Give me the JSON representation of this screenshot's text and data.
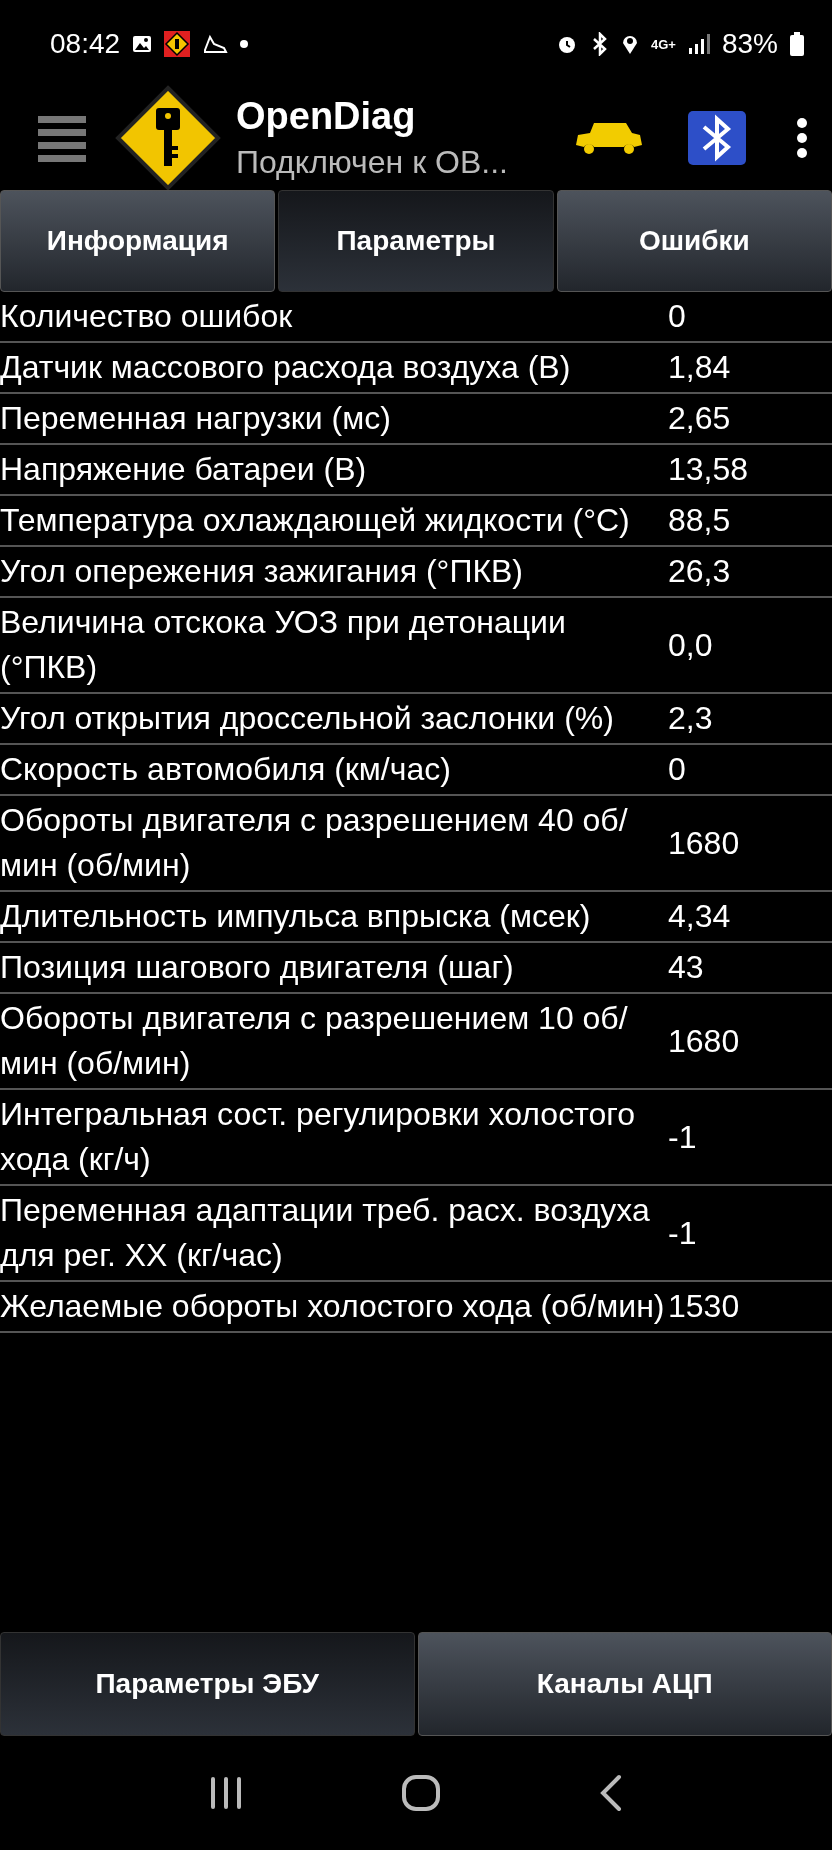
{
  "status_bar": {
    "time": "08:42",
    "network": "4G+",
    "battery": "83%"
  },
  "app_bar": {
    "title": "OpenDiag",
    "subtitle": "Подключен к OB..."
  },
  "tabs": [
    {
      "label": "Информация",
      "selected": false
    },
    {
      "label": "Параметры",
      "selected": true
    },
    {
      "label": "Ошибки",
      "selected": false
    }
  ],
  "parameters": [
    {
      "name": "Количество ошибок",
      "value": "0"
    },
    {
      "name": "Датчик массового расхода воздуха (В)",
      "value": "1,84"
    },
    {
      "name": "Переменная нагрузки (мс)",
      "value": "2,65"
    },
    {
      "name": "Напряжение батареи (В)",
      "value": "13,58"
    },
    {
      "name": "Температура охлаждающей жидкости (°С)",
      "value": "88,5"
    },
    {
      "name": "Угол опережения зажигания (°ПКВ)",
      "value": "26,3"
    },
    {
      "name": "Величина отскока УОЗ при детонации (°ПКВ)",
      "value": "0,0"
    },
    {
      "name": "Угол открытия дроссельной заслонки (%)",
      "value": "2,3"
    },
    {
      "name": "Скорость автомобиля (км/час)",
      "value": "0"
    },
    {
      "name": "Обороты двигателя с разрешением 40 об/мин (об/мин)",
      "value": "1680"
    },
    {
      "name": "Длительность импульса впрыска (мсек)",
      "value": "4,34"
    },
    {
      "name": "Позиция шагового двигателя (шаг)",
      "value": "43"
    },
    {
      "name": "Обороты двигателя с разрешением 10 об/мин (об/мин)",
      "value": "1680"
    },
    {
      "name": "Интегральная сост. регулировки холостого хода (кг/ч)",
      "value": "-1"
    },
    {
      "name": "Переменная адаптации треб. расх. воздуха для рег. XX (кг/час)",
      "value": "-1"
    },
    {
      "name": "Желаемые обороты холостого хода (об/мин)",
      "value": "1530"
    }
  ],
  "bottom_tabs": [
    {
      "label": "Параметры ЭБУ",
      "selected": true
    },
    {
      "label": "Каналы АЦП",
      "selected": false
    }
  ]
}
